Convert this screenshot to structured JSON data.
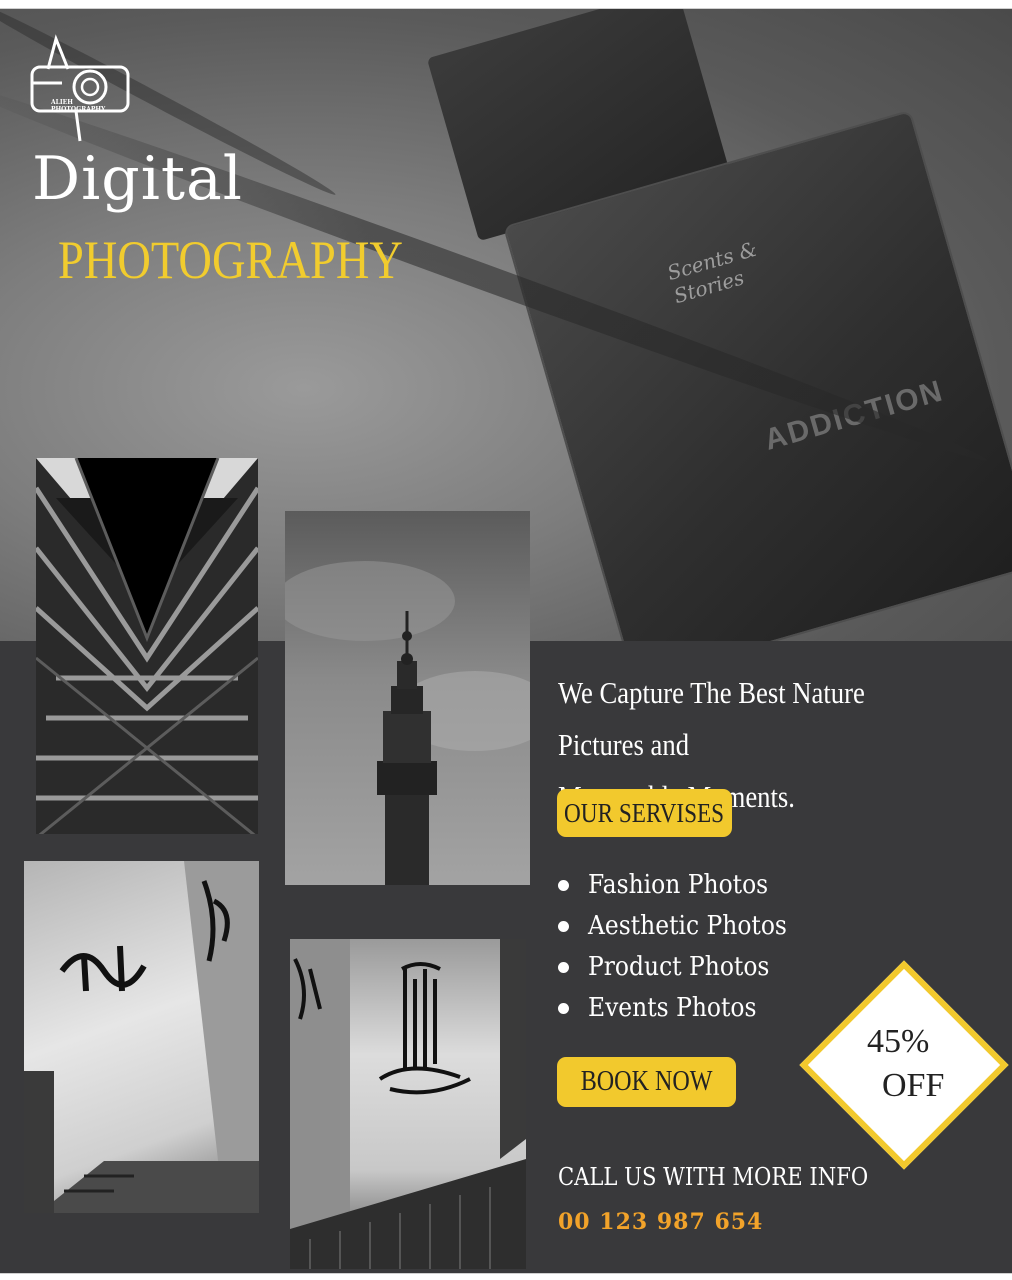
{
  "brand": {
    "logo_text_line1": "ALIEH",
    "logo_text_line2": "PHOTOGRAPHY"
  },
  "hero": {
    "title_line1": "Digital",
    "title_line2": "PHOTOGRAPHY",
    "bottle_brand": "Scents & Stories",
    "bottle_name": "ADDICTION"
  },
  "content": {
    "tagline_line1": "We Capture The Best  Nature Pictures and",
    "tagline_line2": "Memorable Moments.",
    "services_heading": "OUR  SERVISES",
    "services": [
      "Fashion Photos",
      "Aesthetic Photos",
      "Product Photos",
      "Events Photos"
    ],
    "cta_label": "BOOK NOW",
    "discount_value": "45%",
    "discount_off": "OFF",
    "contact_label": "CALL US WITH MORE INFO",
    "phone": "00 123 987 654"
  },
  "colors": {
    "accent_yellow": "#f2c92d",
    "phone_orange": "#f2a32a",
    "panel_dark": "#39393b"
  }
}
